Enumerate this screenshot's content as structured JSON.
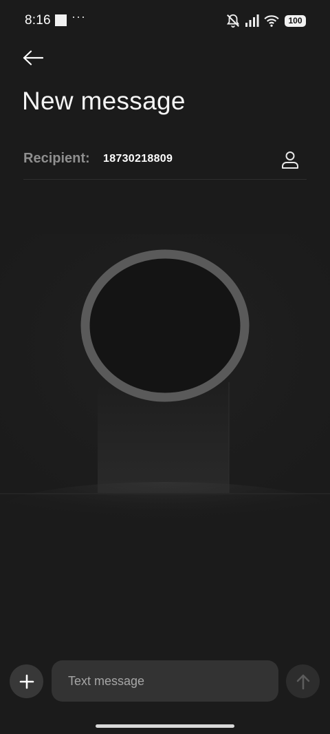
{
  "status_bar": {
    "time": "8:16",
    "more_indicator": "···",
    "battery": "100",
    "icons": [
      "notification-square-icon",
      "mute-bell-icon",
      "cellular-signal-icon",
      "wifi-icon",
      "battery-icon"
    ]
  },
  "header": {
    "back_icon": "arrow-left-icon",
    "title": "New message"
  },
  "recipient": {
    "label": "Recipient:",
    "value": "18730218809",
    "contact_icon": "person-icon"
  },
  "composer": {
    "attach_icon": "plus-icon",
    "placeholder": "Text message",
    "value": "",
    "send_icon": "arrow-up-icon"
  },
  "colors": {
    "background": "#1b1b1b",
    "text_primary": "#ffffff",
    "text_secondary": "#8f8f8f",
    "field": "#333333",
    "ring": "#5a5a5a"
  }
}
